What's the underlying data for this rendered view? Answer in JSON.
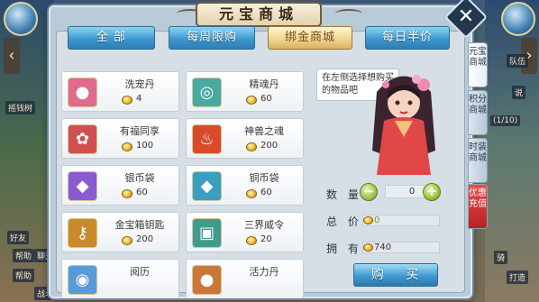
{
  "title": "元宝商城",
  "close_label": "✕",
  "tabs": [
    {
      "label": "全 部",
      "active": false
    },
    {
      "label": "每周限购",
      "active": false
    },
    {
      "label": "绑金商城",
      "active": true
    },
    {
      "label": "每日半价",
      "active": false
    }
  ],
  "items": [
    {
      "name": "洗宠丹",
      "price": "4",
      "icon": "pet-wash-pill-icon",
      "color": "#e06b8a"
    },
    {
      "name": "精魂丹",
      "price": "60",
      "icon": "soul-pill-icon",
      "color": "#48a9a0"
    },
    {
      "name": "有福同享",
      "price": "100",
      "icon": "blessing-share-icon",
      "color": "#d24f4f"
    },
    {
      "name": "神兽之魂",
      "price": "200",
      "icon": "beast-soul-icon",
      "color": "#d84a2a"
    },
    {
      "name": "银币袋",
      "price": "60",
      "icon": "silver-coin-bag-icon",
      "color": "#8a5ad0"
    },
    {
      "name": "铜币袋",
      "price": "60",
      "icon": "copper-coin-bag-icon",
      "color": "#3a9ec0"
    },
    {
      "name": "金宝箱钥匙",
      "price": "200",
      "icon": "gold-chest-key-icon",
      "color": "#c98a2a"
    },
    {
      "name": "三界威令",
      "price": "20",
      "icon": "three-realms-token-icon",
      "color": "#3f9c8a"
    },
    {
      "name": "阅历",
      "price": "",
      "icon": "experience-icon",
      "color": "#5a9ad8"
    },
    {
      "name": "活力丹",
      "price": "",
      "icon": "vitality-pill-icon",
      "color": "#c9783a"
    }
  ],
  "hint": "在左侧选择想购买的物品吧",
  "quantity": {
    "label": "数 量",
    "value": "0",
    "minus": "−",
    "plus": "+"
  },
  "total": {
    "label": "总 价",
    "value": "0"
  },
  "owned": {
    "label": "拥 有",
    "value": "740"
  },
  "buy_label": "购 买",
  "side_tabs": [
    "元宝商城",
    "积分商城",
    "时装商城",
    "优惠充值"
  ],
  "background": {
    "left": [
      "摇钱树",
      "好友",
      "帮助",
      "聊天",
      "帮助",
      "战斗"
    ],
    "right": [
      "队伍",
      "说",
      "(1/10)",
      "骑",
      "打造"
    ]
  },
  "colors": {
    "accent": "#3d98cf",
    "active_tab": "#f1d592",
    "gold": "#e8b52e"
  }
}
